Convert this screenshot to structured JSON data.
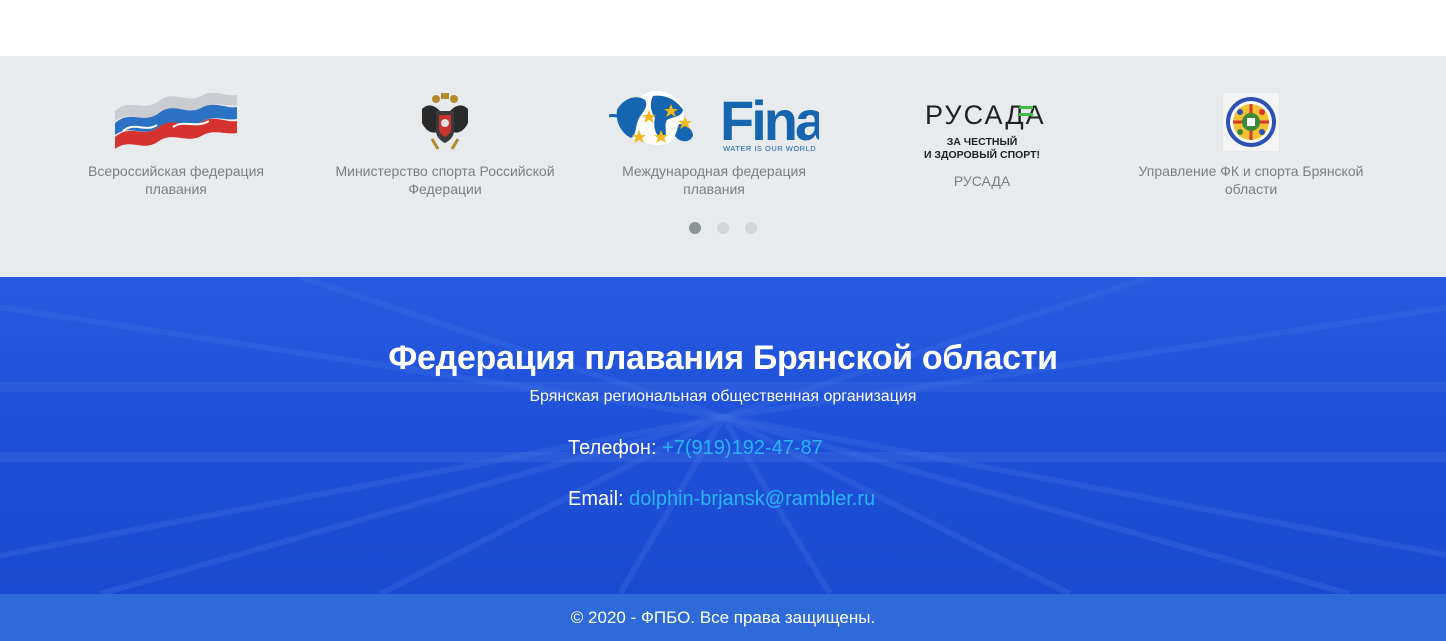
{
  "partners": [
    {
      "caption": "Всероссийская федерация плавания",
      "icon": "vfp-flag-waves-logo"
    },
    {
      "caption": "Министерство спорта Российской Федерации",
      "icon": "double-headed-eagle-emblem"
    },
    {
      "caption": "Международная федерация плавания",
      "icon": "fina-globe-logo",
      "logo_text": "Fina",
      "logo_tagline": "WATER IS OUR WORLD"
    },
    {
      "caption": "РУСАДА",
      "icon": "rusada-logo",
      "logo_text": "РУСАДА",
      "logo_slogan_1": "ЗА ЧЕСТНЫЙ",
      "logo_slogan_2": "И ЗДОРОВЫЙ СПОРТ!"
    },
    {
      "caption": "Управление ФК и спорта Брянской области",
      "icon": "bryansk-sport-emblem"
    }
  ],
  "carousel": {
    "slide_count": 3,
    "active_index": 0
  },
  "footer": {
    "title": "Федерация плавания Брянской области",
    "subtitle": "Брянская региональная общественная организация",
    "phone_label": "Телефон:",
    "phone_value": "+7(919)192-47-87",
    "email_label": "Email:",
    "email_value": "dolphin-brjansk@rambler.ru"
  },
  "copyright": "© 2020 - ФПБО. Все права защищены.",
  "colors": {
    "partners_bg": "#e8ebee",
    "footer_bg": "#1f4fd6",
    "link": "#29b5f3",
    "copyright_bg": "#2e6ad8",
    "fina_blue": "#1565b0"
  }
}
